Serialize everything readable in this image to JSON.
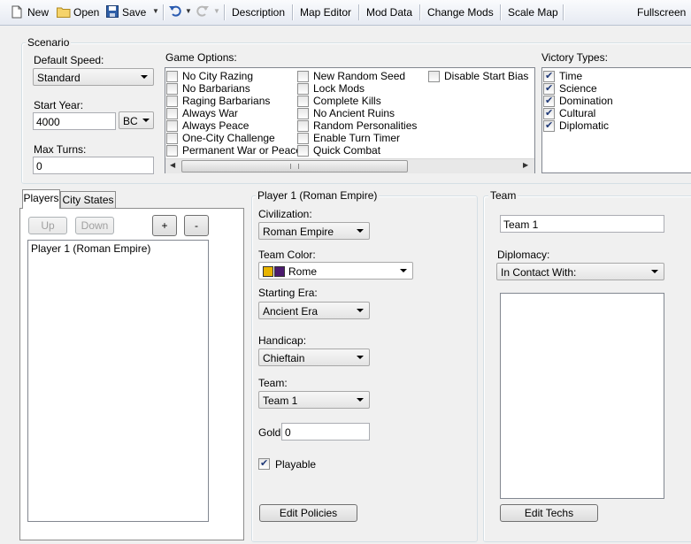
{
  "toolbar": {
    "new_label": "New",
    "open_label": "Open",
    "save_label": "Save",
    "description_label": "Description",
    "map_editor_label": "Map Editor",
    "mod_data_label": "Mod Data",
    "change_mods_label": "Change Mods",
    "scale_map_label": "Scale Map",
    "fullscreen_label": "Fullscreen"
  },
  "scenario": {
    "title": "Scenario",
    "default_speed_label": "Default Speed:",
    "default_speed_value": "Standard",
    "start_year_label": "Start Year:",
    "start_year_value": "4000",
    "era_value": "BC",
    "max_turns_label": "Max Turns:",
    "max_turns_value": "0",
    "game_options_label": "Game Options:",
    "game_options": [
      {
        "label": "No City Razing",
        "checked": false
      },
      {
        "label": "No Barbarians",
        "checked": false
      },
      {
        "label": "Raging Barbarians",
        "checked": false
      },
      {
        "label": "Always War",
        "checked": false
      },
      {
        "label": "Always Peace",
        "checked": false
      },
      {
        "label": "One-City Challenge",
        "checked": false
      },
      {
        "label": "Permanent War or Peace",
        "checked": false
      },
      {
        "label": "New Random Seed",
        "checked": false
      },
      {
        "label": "Lock Mods",
        "checked": false
      },
      {
        "label": "Complete Kills",
        "checked": false
      },
      {
        "label": "No Ancient Ruins",
        "checked": false
      },
      {
        "label": "Random Personalities",
        "checked": false
      },
      {
        "label": "Enable Turn Timer",
        "checked": false
      },
      {
        "label": "Quick Combat",
        "checked": false
      },
      {
        "label": "Disable Start Bias",
        "checked": false
      }
    ],
    "victory_types_label": "Victory Types:",
    "victory_types": [
      {
        "label": "Time",
        "checked": true
      },
      {
        "label": "Science",
        "checked": true
      },
      {
        "label": "Domination",
        "checked": true
      },
      {
        "label": "Cultural",
        "checked": true
      },
      {
        "label": "Diplomatic",
        "checked": true
      }
    ]
  },
  "players_panel": {
    "tab_players": "Players",
    "tab_city_states": "City States",
    "up_label": "Up",
    "down_label": "Down",
    "add_label": "+",
    "remove_label": "-",
    "players": [
      "Player 1 (Roman Empire)"
    ]
  },
  "player_detail": {
    "title": "Player 1 (Roman Empire)",
    "civilization_label": "Civilization:",
    "civilization_value": "Roman Empire",
    "team_color_label": "Team Color:",
    "team_color_value": "Rome",
    "team_color_primary": "#e8b400",
    "team_color_secondary": "#4b1a6e",
    "starting_era_label": "Starting Era:",
    "starting_era_value": "Ancient Era",
    "handicap_label": "Handicap:",
    "handicap_value": "Chieftain",
    "team_label": "Team:",
    "team_value": "Team 1",
    "gold_label": "Gold:",
    "gold_value": "0",
    "playable_label": "Playable",
    "playable_checked": true,
    "edit_policies_label": "Edit Policies"
  },
  "team_panel": {
    "title": "Team",
    "team_name_value": "Team 1",
    "diplomacy_label": "Diplomacy:",
    "diplomacy_value": "In Contact With:",
    "edit_techs_label": "Edit Techs"
  }
}
